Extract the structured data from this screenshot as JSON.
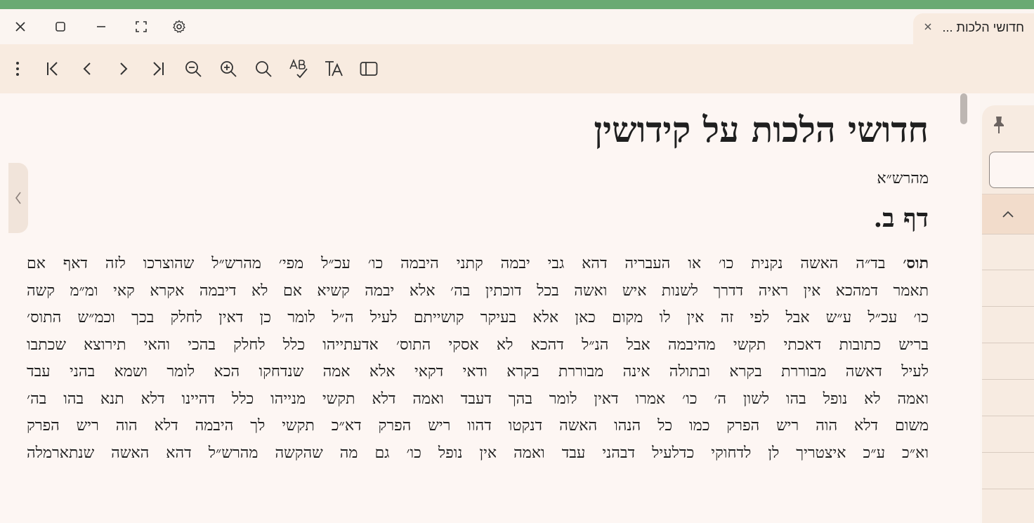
{
  "window": {
    "tab_title": "חדושי הלכות ...",
    "titlebar_icons": [
      "close-icon",
      "restore-icon",
      "minimize-icon",
      "fullscreen-icon",
      "gear-icon"
    ]
  },
  "toolbar": {
    "icons": [
      "more-vert-icon",
      "first-page-icon",
      "prev-page-icon",
      "next-page-icon",
      "last-page-icon",
      "zoom-out-icon",
      "zoom-in-icon",
      "search-icon",
      "spellcheck-icon",
      "font-size-icon",
      "sidebar-icon"
    ]
  },
  "document": {
    "title": "חדושי הלכות על קידושין",
    "author": "מהרש״א",
    "heading": "דף ב.",
    "lead_bold": "תוס׳",
    "lines": [
      " בד״ה האשה נקנית כו׳ או העבריה דהא גבי יבמה קתני היבמה כו׳ עכ״ל מפי׳ מהרש״ל שהוצרכו לזה דאף אם",
      "תאמר דמהכא אין ראיה דדרך לשנות איש ואשה בכל דוכתין בה׳ אלא יבמה קשיא אם לא דיבמה אקרא קאי ומ״מ קשה",
      "כו׳ עכ״ל ע״ש אבל לפי זה אין לו מקום כאן אלא בעיקר קושייתם לעיל ה״ל לומר כן דאין לחלק בכך וכמ״ש התוס׳",
      "בריש כתובות דאכתי תקשי מהיבמה אבל הנ״ל דהכא לא אסקי התוס׳ אדעתייהו כלל לחלק בהכי והאי תירוצא שכתבו",
      "לעיל דאשה מבוררת בקרא ובתולה אינה מבוררת בקרא ודאי דקאי אלא אמה שנדחקו הכא לומר ושמא בהני עבד",
      "ואמה לא נופל בהו לשון ה׳ כו׳ אמרו דאין לומר בהך דעבד ואמה דלא תקשי מנייהו כלל דהיינו דלא תנא בהו בה׳",
      "משום דלא הוה ריש הפרק כמו כל הנהו האשה דנקטו דהוו ריש הפרק דא״כ תקשי לך היבמה דלא הוה ריש הפרק",
      "וא״כ ע״כ איצטריך לן לדחוקי כדלעיל דבהני עבד ואמה אין נופל כו׳ גם מה שהקשה מהרש״ל דהא האשה שנתארמלה"
    ]
  },
  "right_panel": {
    "pin_icon": "pin-icon",
    "search_value": "",
    "collapse_icon": "chevron-up-icon"
  },
  "colors": {
    "accent_green": "#6aaa73",
    "toolbar_bg": "#f8ebe0",
    "page_bg": "#fdf6f3"
  }
}
